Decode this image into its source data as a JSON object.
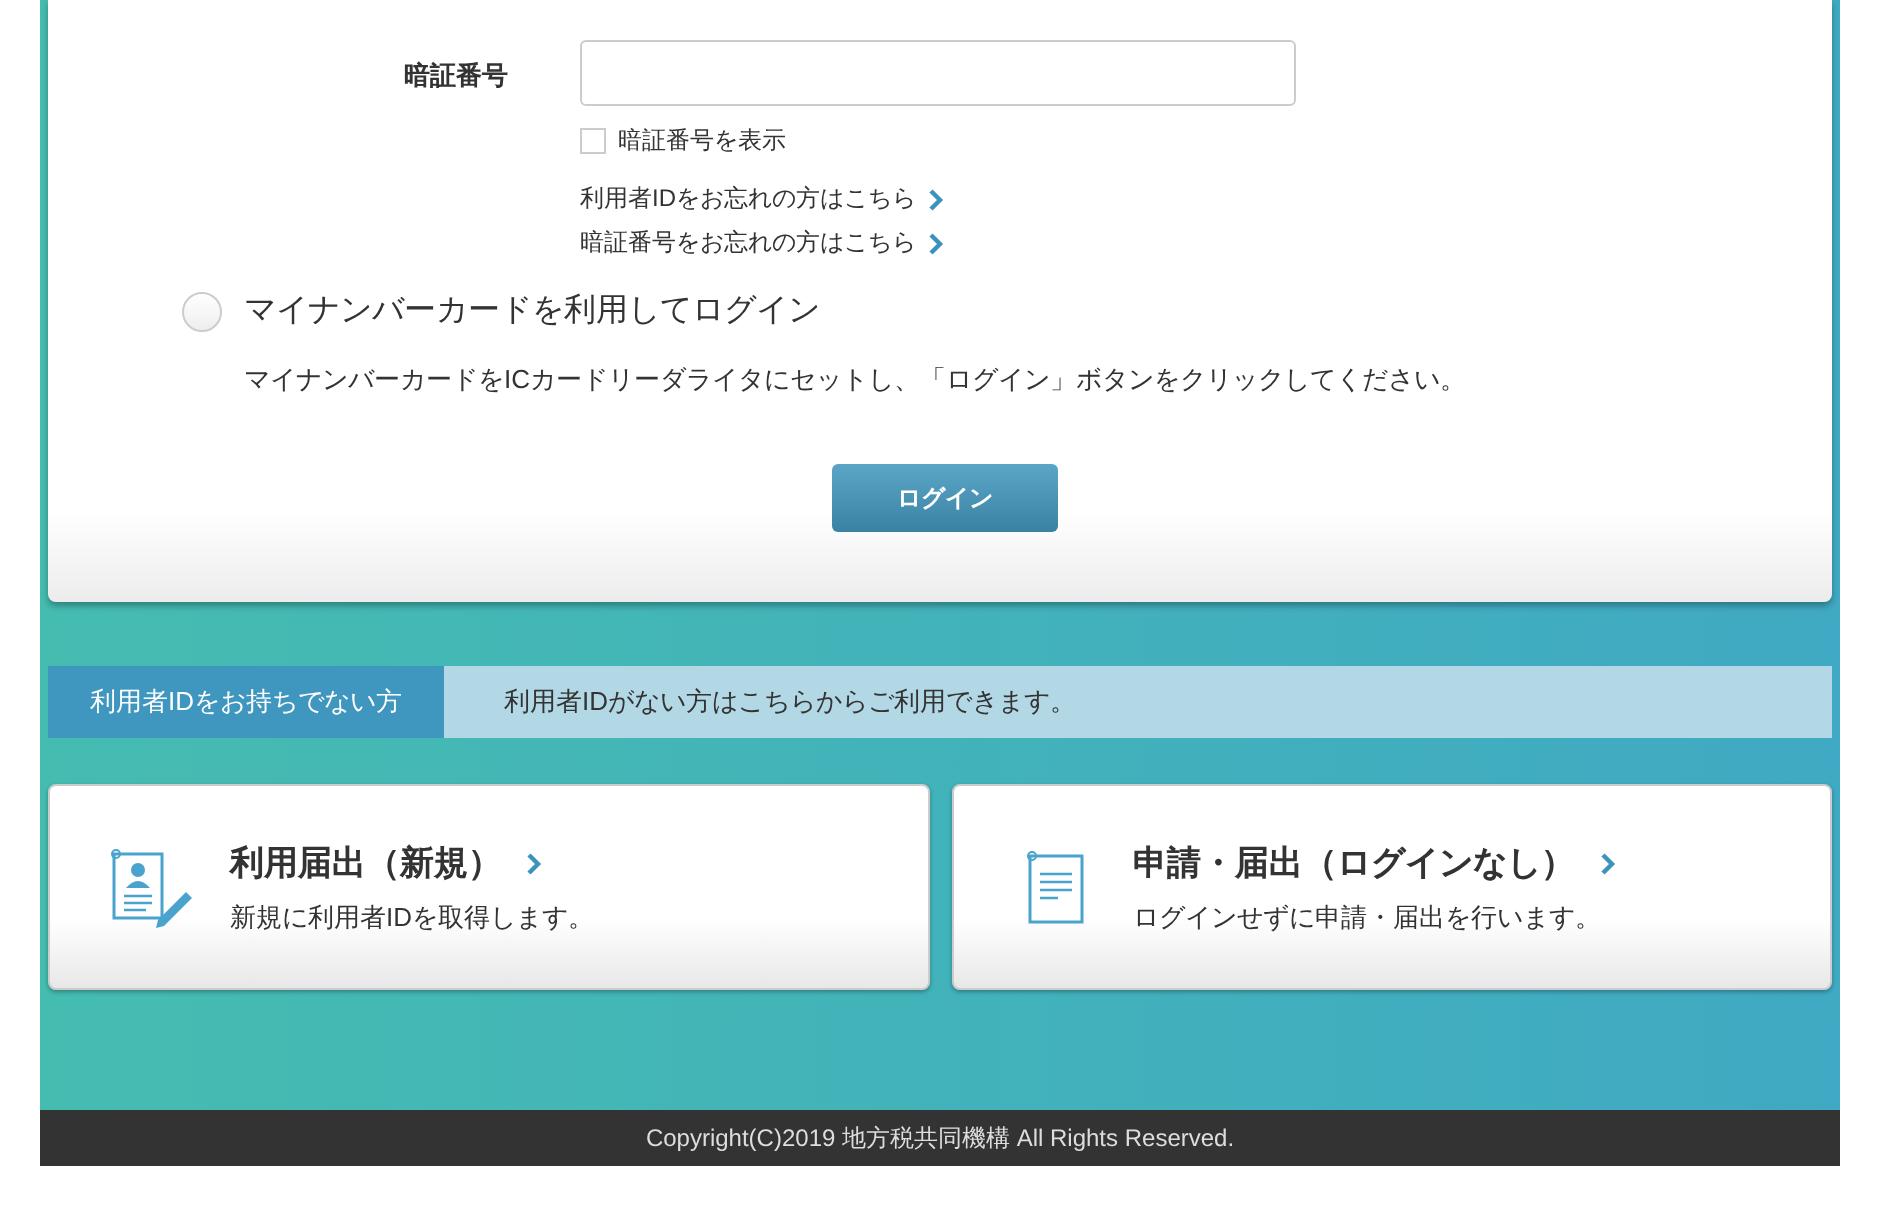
{
  "password_field": {
    "label": "暗証番号"
  },
  "show_password": {
    "label": "暗証番号を表示",
    "checked": false
  },
  "links": [
    {
      "label": "利用者IDをお忘れの方はこちら"
    },
    {
      "label": "暗証番号をお忘れの方はこちら"
    }
  ],
  "mynumber_option": {
    "label": "マイナンバーカードを利用してログイン",
    "selected": false,
    "description": "マイナンバーカードをICカードリーダライタにセットし、「ログイン」ボタンをクリックしてください。"
  },
  "login_button": "ログイン",
  "no_id_banner": {
    "heading": "利用者IDをお持ちでない方",
    "text": "利用者IDがない方はこちらからご利用できます。"
  },
  "cards": [
    {
      "kind": "register",
      "title": "利用届出（新規）",
      "subtitle": "新規に利用者IDを取得します。"
    },
    {
      "kind": "document",
      "title": "申請・届出（ログインなし）",
      "subtitle": "ログインせずに申請・届出を行います。"
    }
  ],
  "footer": "Copyright(C)2019 地方税共同機構 All Rights Reserved."
}
